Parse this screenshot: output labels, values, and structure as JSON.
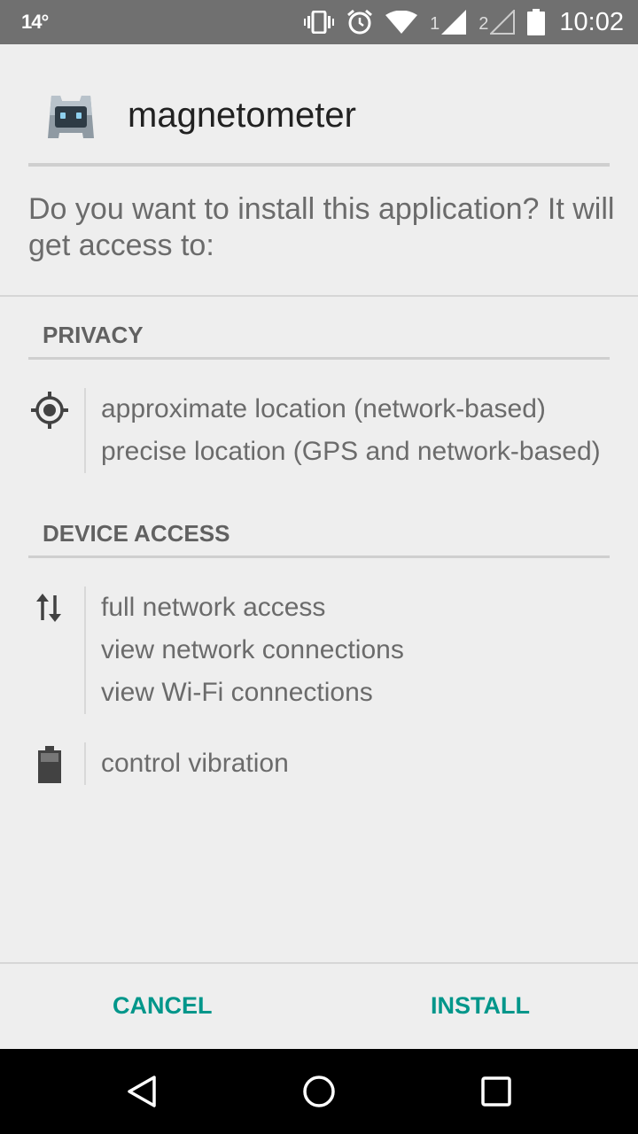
{
  "status_bar": {
    "temperature": "14°",
    "sim1_label": "1",
    "sim2_label": "2",
    "time": "10:02",
    "icons": [
      "vibrate-icon",
      "alarm-icon",
      "wifi-icon",
      "signal-icon",
      "battery-icon"
    ]
  },
  "app": {
    "name": "magnetometer",
    "icon": "cordova-robot-icon"
  },
  "prompt": "Do you want to install this application? It will get access to:",
  "sections": {
    "privacy": {
      "title": "PRIVACY",
      "groups": [
        {
          "icon": "location-target-icon",
          "items": [
            "approximate location (network-based)",
            "precise location (GPS and network-based)"
          ]
        }
      ]
    },
    "device_access": {
      "title": "DEVICE ACCESS",
      "groups": [
        {
          "icon": "network-arrows-icon",
          "items": [
            "full network access",
            "view network connections",
            "view Wi-Fi connections"
          ]
        },
        {
          "icon": "battery-vibration-icon",
          "items": [
            "control vibration"
          ]
        }
      ]
    }
  },
  "buttons": {
    "cancel": "CANCEL",
    "install": "INSTALL"
  },
  "colors": {
    "accent": "#00968a",
    "status_bar": "#707070",
    "background": "#eeeeee"
  }
}
